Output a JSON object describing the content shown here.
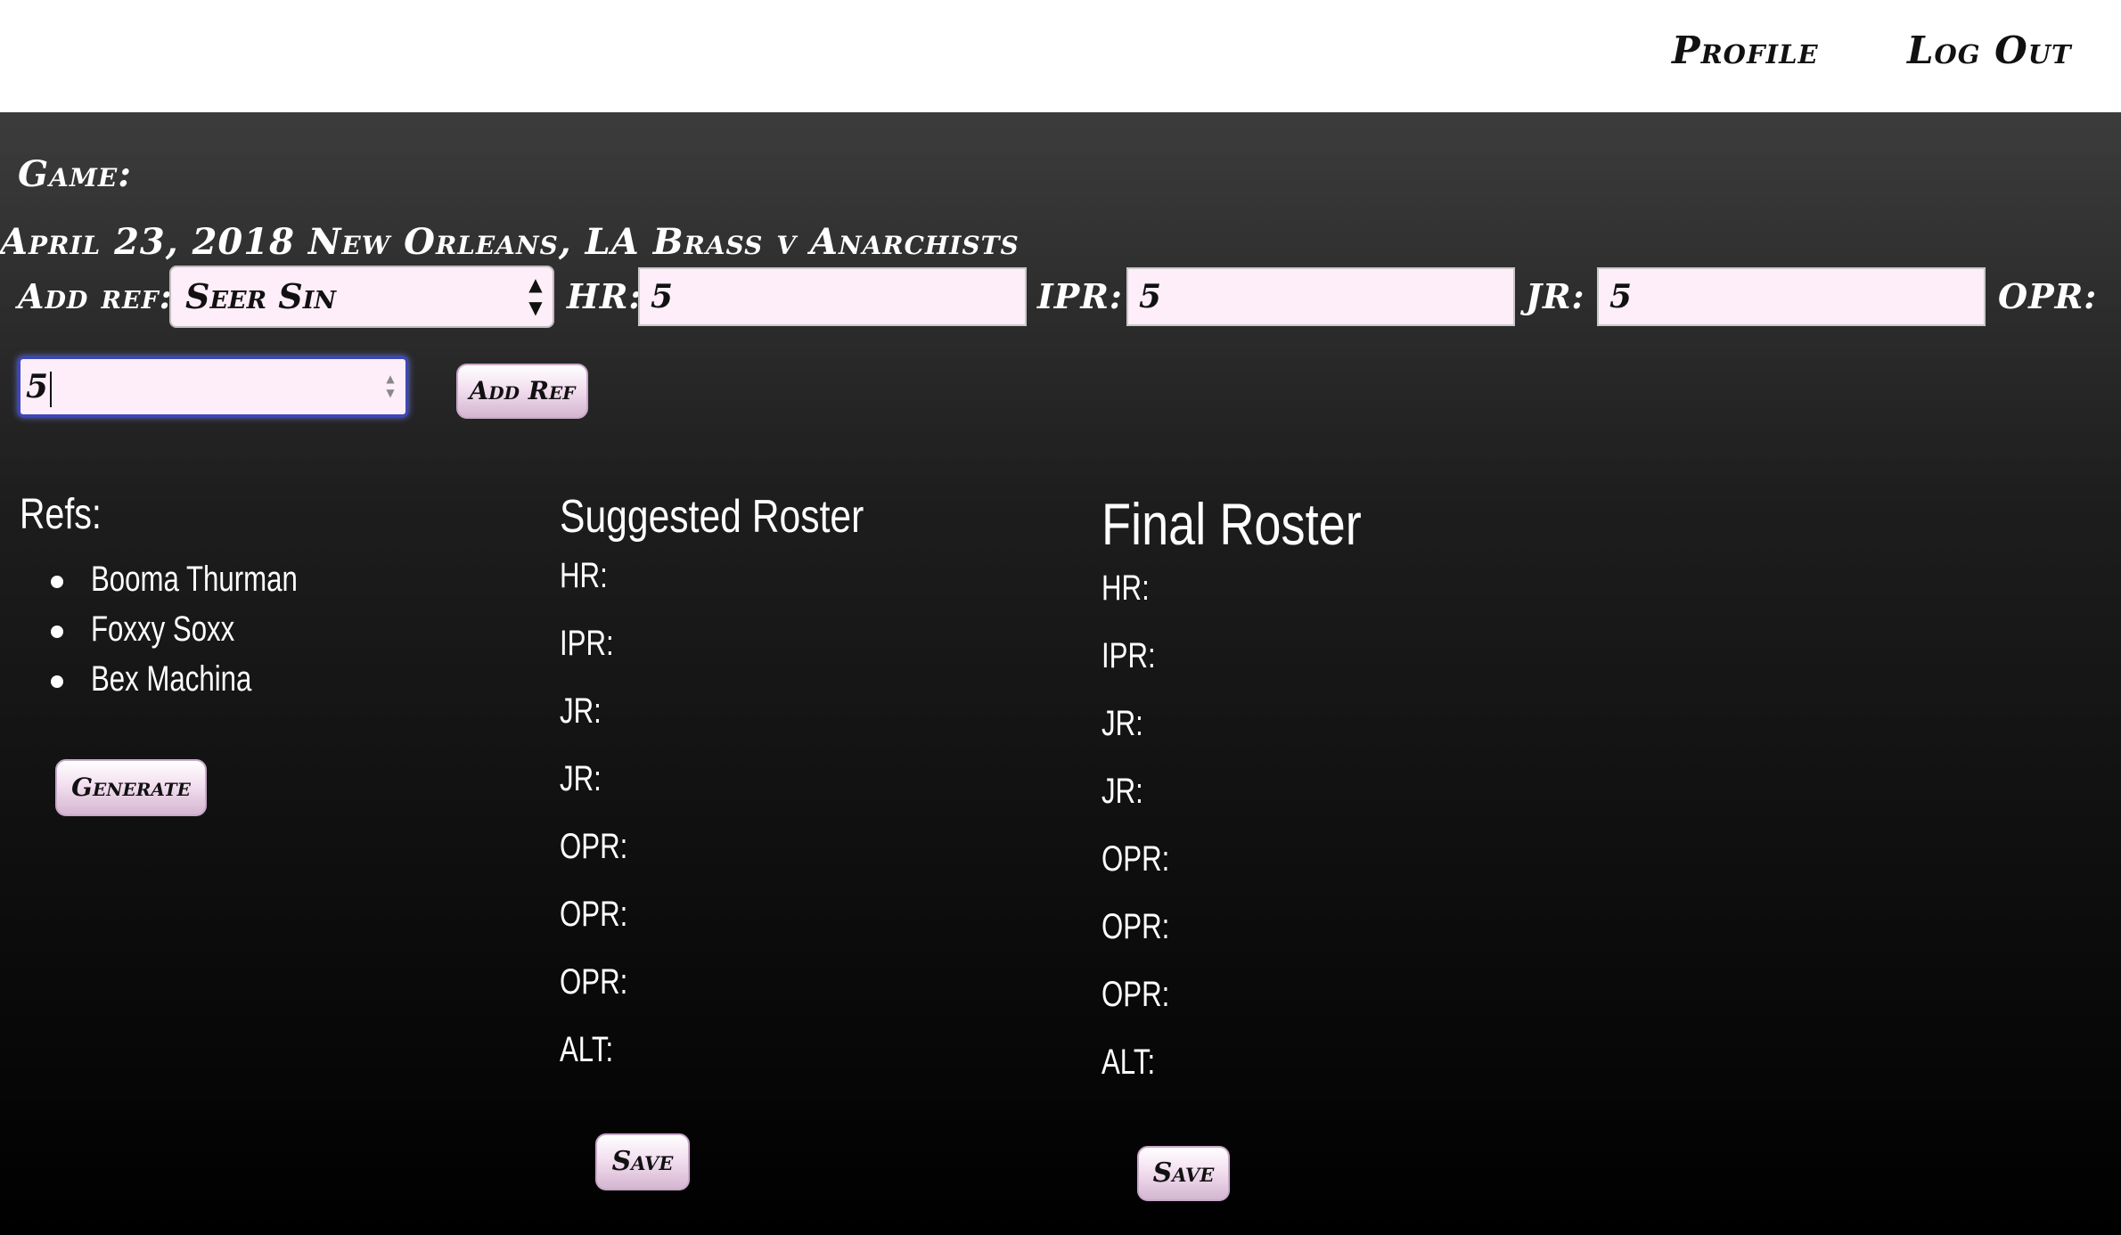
{
  "nav": {
    "profile": "Profile",
    "logout": "Log Out"
  },
  "game": {
    "label": "Game:",
    "description": "April 23, 2018 New Orleans, LA Brass v Anarchists"
  },
  "add_ref_form": {
    "add_ref_label": "Add ref:",
    "selected_ref": "Seer Sin",
    "hr_label": "HR:",
    "hr_value": "5",
    "ipr_label": "IPR:",
    "ipr_value": "5",
    "jr_label": "JR:",
    "jr_value": "5",
    "opr_label": "OPR:",
    "opr_value": "5",
    "add_button": "Add Ref"
  },
  "refs": {
    "title": "Refs:",
    "items": [
      "Booma Thurman",
      "Foxxy Soxx",
      "Bex Machina"
    ],
    "generate_button": "Generate"
  },
  "suggested_roster": {
    "title": "Suggested Roster",
    "positions": [
      "HR:",
      "IPR:",
      "JR:",
      "JR:",
      "OPR:",
      "OPR:",
      "OPR:",
      "ALT:"
    ],
    "save_button": "Save"
  },
  "final_roster": {
    "title": "Final Roster",
    "positions": [
      "HR:",
      "IPR:",
      "JR:",
      "JR:",
      "OPR:",
      "OPR:",
      "OPR:",
      "ALT:"
    ],
    "save_button": "Save"
  },
  "colors": {
    "topbar": "#ffffff",
    "field_background": "#fdeef9",
    "focus_border": "#3d47b8",
    "text_light": "#ffffff"
  },
  "icons": {
    "select_arrows": "updown-arrows-icon",
    "spinner": "spinner-arrows-icon"
  }
}
